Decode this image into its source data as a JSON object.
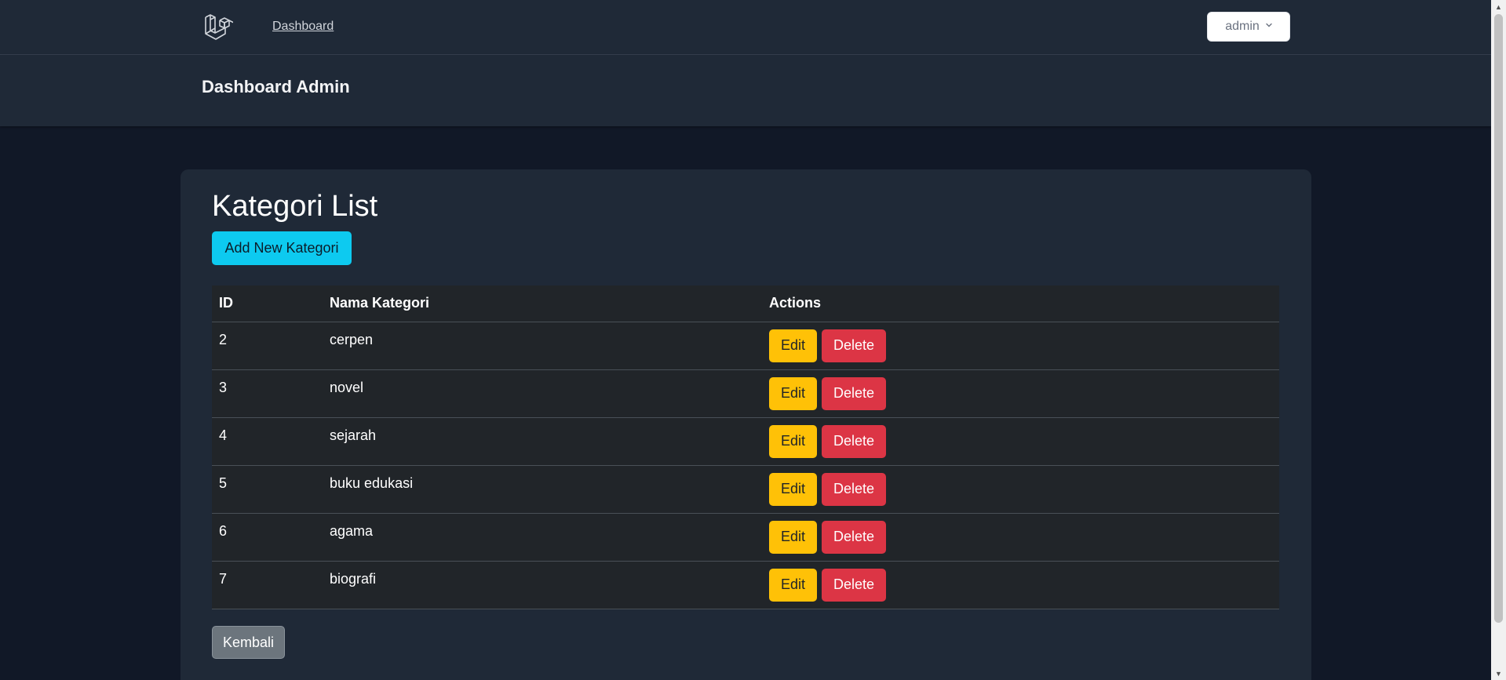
{
  "nav": {
    "logo_icon": "laravel-logo-icon",
    "dashboard_link": "Dashboard",
    "user_menu": {
      "label": "admin",
      "icon": "chevron-down-icon"
    }
  },
  "header": {
    "title": "Dashboard Admin"
  },
  "card": {
    "title": "Kategori List",
    "add_button": "Add New Kategori",
    "back_button": "Kembali"
  },
  "table": {
    "columns": [
      "ID",
      "Nama Kategori",
      "Actions"
    ],
    "rows": [
      {
        "id": "2",
        "name": "cerpen"
      },
      {
        "id": "3",
        "name": "novel"
      },
      {
        "id": "4",
        "name": "sejarah"
      },
      {
        "id": "5",
        "name": "buku edukasi"
      },
      {
        "id": "6",
        "name": "agama"
      },
      {
        "id": "7",
        "name": "biografi"
      }
    ],
    "edit_label": "Edit",
    "delete_label": "Delete"
  },
  "colors": {
    "page_bg": "#111827",
    "panel_bg": "#1f2937",
    "table_bg": "#212529",
    "info": "#0dcaf0",
    "warning": "#ffc107",
    "danger": "#dc3545",
    "secondary": "#6c757d"
  }
}
